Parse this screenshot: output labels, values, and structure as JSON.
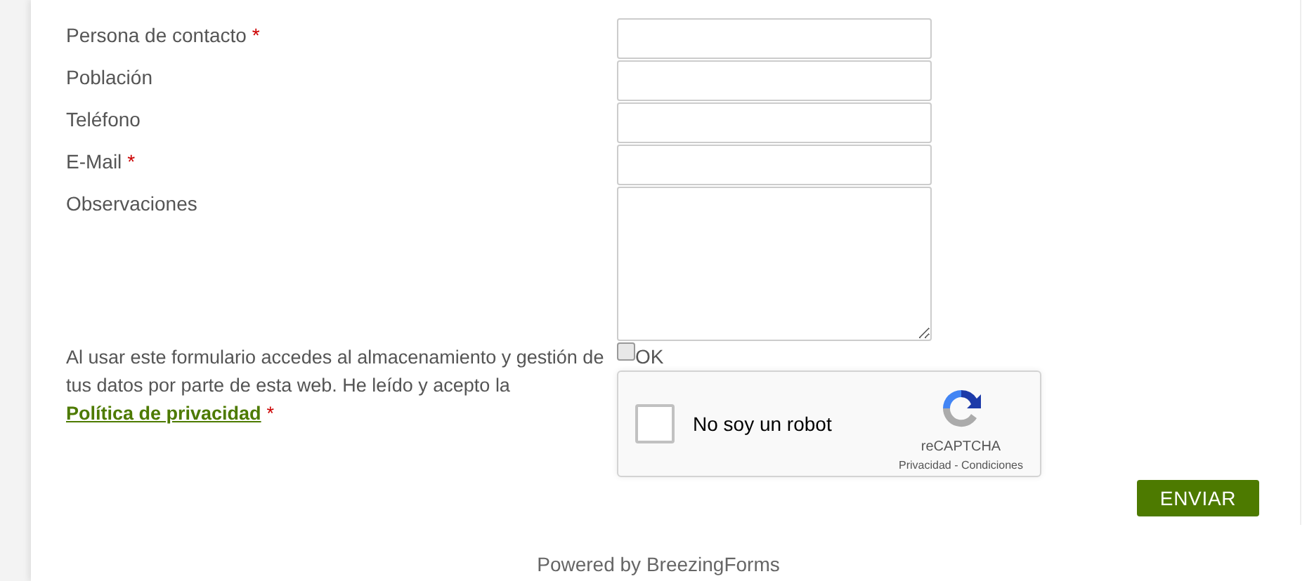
{
  "fields": [
    {
      "label": "Persona de contacto",
      "required_mark": "*",
      "kind": "text"
    },
    {
      "label": "Población",
      "kind": "text"
    },
    {
      "label": "Teléfono",
      "kind": "text"
    },
    {
      "label": "E-Mail",
      "required_mark": "*",
      "kind": "text"
    },
    {
      "label": "Observaciones",
      "kind": "textarea"
    }
  ],
  "consent": {
    "text": "Al usar este formulario accedes al almacenamiento y gestión de tus datos por parte de esta web. He leído y acepto la",
    "link": "Política de privacidad",
    "required_mark": "*",
    "checkbox_label": "OK",
    "checked": false
  },
  "captcha": {
    "label": "No soy un robot",
    "checked": false,
    "brand": "reCAPTCHA",
    "links": "Privacidad - Condiciones"
  },
  "submit": "ENVIAR",
  "footer": "Powered by BreezingForms"
}
